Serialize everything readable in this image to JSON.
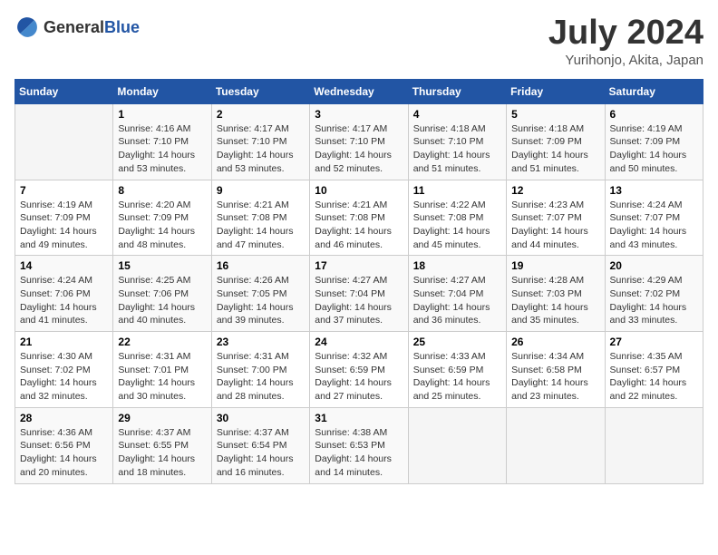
{
  "header": {
    "logo_general": "General",
    "logo_blue": "Blue",
    "month": "July 2024",
    "location": "Yurihonjo, Akita, Japan"
  },
  "weekdays": [
    "Sunday",
    "Monday",
    "Tuesday",
    "Wednesday",
    "Thursday",
    "Friday",
    "Saturday"
  ],
  "weeks": [
    [
      {
        "day": "",
        "info": ""
      },
      {
        "day": "1",
        "info": "Sunrise: 4:16 AM\nSunset: 7:10 PM\nDaylight: 14 hours\nand 53 minutes."
      },
      {
        "day": "2",
        "info": "Sunrise: 4:17 AM\nSunset: 7:10 PM\nDaylight: 14 hours\nand 53 minutes."
      },
      {
        "day": "3",
        "info": "Sunrise: 4:17 AM\nSunset: 7:10 PM\nDaylight: 14 hours\nand 52 minutes."
      },
      {
        "day": "4",
        "info": "Sunrise: 4:18 AM\nSunset: 7:10 PM\nDaylight: 14 hours\nand 51 minutes."
      },
      {
        "day": "5",
        "info": "Sunrise: 4:18 AM\nSunset: 7:09 PM\nDaylight: 14 hours\nand 51 minutes."
      },
      {
        "day": "6",
        "info": "Sunrise: 4:19 AM\nSunset: 7:09 PM\nDaylight: 14 hours\nand 50 minutes."
      }
    ],
    [
      {
        "day": "7",
        "info": "Sunrise: 4:19 AM\nSunset: 7:09 PM\nDaylight: 14 hours\nand 49 minutes."
      },
      {
        "day": "8",
        "info": "Sunrise: 4:20 AM\nSunset: 7:09 PM\nDaylight: 14 hours\nand 48 minutes."
      },
      {
        "day": "9",
        "info": "Sunrise: 4:21 AM\nSunset: 7:08 PM\nDaylight: 14 hours\nand 47 minutes."
      },
      {
        "day": "10",
        "info": "Sunrise: 4:21 AM\nSunset: 7:08 PM\nDaylight: 14 hours\nand 46 minutes."
      },
      {
        "day": "11",
        "info": "Sunrise: 4:22 AM\nSunset: 7:08 PM\nDaylight: 14 hours\nand 45 minutes."
      },
      {
        "day": "12",
        "info": "Sunrise: 4:23 AM\nSunset: 7:07 PM\nDaylight: 14 hours\nand 44 minutes."
      },
      {
        "day": "13",
        "info": "Sunrise: 4:24 AM\nSunset: 7:07 PM\nDaylight: 14 hours\nand 43 minutes."
      }
    ],
    [
      {
        "day": "14",
        "info": "Sunrise: 4:24 AM\nSunset: 7:06 PM\nDaylight: 14 hours\nand 41 minutes."
      },
      {
        "day": "15",
        "info": "Sunrise: 4:25 AM\nSunset: 7:06 PM\nDaylight: 14 hours\nand 40 minutes."
      },
      {
        "day": "16",
        "info": "Sunrise: 4:26 AM\nSunset: 7:05 PM\nDaylight: 14 hours\nand 39 minutes."
      },
      {
        "day": "17",
        "info": "Sunrise: 4:27 AM\nSunset: 7:04 PM\nDaylight: 14 hours\nand 37 minutes."
      },
      {
        "day": "18",
        "info": "Sunrise: 4:27 AM\nSunset: 7:04 PM\nDaylight: 14 hours\nand 36 minutes."
      },
      {
        "day": "19",
        "info": "Sunrise: 4:28 AM\nSunset: 7:03 PM\nDaylight: 14 hours\nand 35 minutes."
      },
      {
        "day": "20",
        "info": "Sunrise: 4:29 AM\nSunset: 7:02 PM\nDaylight: 14 hours\nand 33 minutes."
      }
    ],
    [
      {
        "day": "21",
        "info": "Sunrise: 4:30 AM\nSunset: 7:02 PM\nDaylight: 14 hours\nand 32 minutes."
      },
      {
        "day": "22",
        "info": "Sunrise: 4:31 AM\nSunset: 7:01 PM\nDaylight: 14 hours\nand 30 minutes."
      },
      {
        "day": "23",
        "info": "Sunrise: 4:31 AM\nSunset: 7:00 PM\nDaylight: 14 hours\nand 28 minutes."
      },
      {
        "day": "24",
        "info": "Sunrise: 4:32 AM\nSunset: 6:59 PM\nDaylight: 14 hours\nand 27 minutes."
      },
      {
        "day": "25",
        "info": "Sunrise: 4:33 AM\nSunset: 6:59 PM\nDaylight: 14 hours\nand 25 minutes."
      },
      {
        "day": "26",
        "info": "Sunrise: 4:34 AM\nSunset: 6:58 PM\nDaylight: 14 hours\nand 23 minutes."
      },
      {
        "day": "27",
        "info": "Sunrise: 4:35 AM\nSunset: 6:57 PM\nDaylight: 14 hours\nand 22 minutes."
      }
    ],
    [
      {
        "day": "28",
        "info": "Sunrise: 4:36 AM\nSunset: 6:56 PM\nDaylight: 14 hours\nand 20 minutes."
      },
      {
        "day": "29",
        "info": "Sunrise: 4:37 AM\nSunset: 6:55 PM\nDaylight: 14 hours\nand 18 minutes."
      },
      {
        "day": "30",
        "info": "Sunrise: 4:37 AM\nSunset: 6:54 PM\nDaylight: 14 hours\nand 16 minutes."
      },
      {
        "day": "31",
        "info": "Sunrise: 4:38 AM\nSunset: 6:53 PM\nDaylight: 14 hours\nand 14 minutes."
      },
      {
        "day": "",
        "info": ""
      },
      {
        "day": "",
        "info": ""
      },
      {
        "day": "",
        "info": ""
      }
    ]
  ]
}
